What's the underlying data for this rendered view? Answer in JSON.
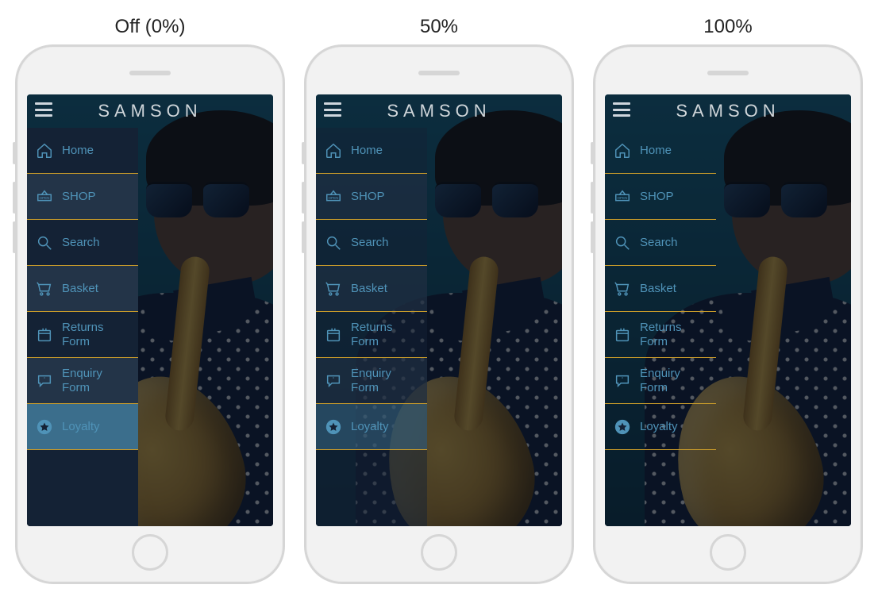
{
  "phones": [
    {
      "caption": "Off (0%)",
      "transparency_pct": 0
    },
    {
      "caption": "50%",
      "transparency_pct": 50
    },
    {
      "caption": "100%",
      "transparency_pct": 100
    }
  ],
  "app": {
    "brand": "SAMSON"
  },
  "nav": {
    "items": [
      {
        "key": "home",
        "label": "Home",
        "icon": "home-icon"
      },
      {
        "key": "shop",
        "label": "SHOP",
        "icon": "shop-sign-icon"
      },
      {
        "key": "search",
        "label": "Search",
        "icon": "search-icon"
      },
      {
        "key": "basket",
        "label": "Basket",
        "icon": "cart-icon"
      },
      {
        "key": "returns",
        "label": "Returns Form",
        "icon": "package-return-icon"
      },
      {
        "key": "enquiry",
        "label": "Enquiry Form",
        "icon": "speech-bubble-icon"
      },
      {
        "key": "loyalty",
        "label": "Loyalty",
        "icon": "star-circle-icon"
      }
    ]
  }
}
